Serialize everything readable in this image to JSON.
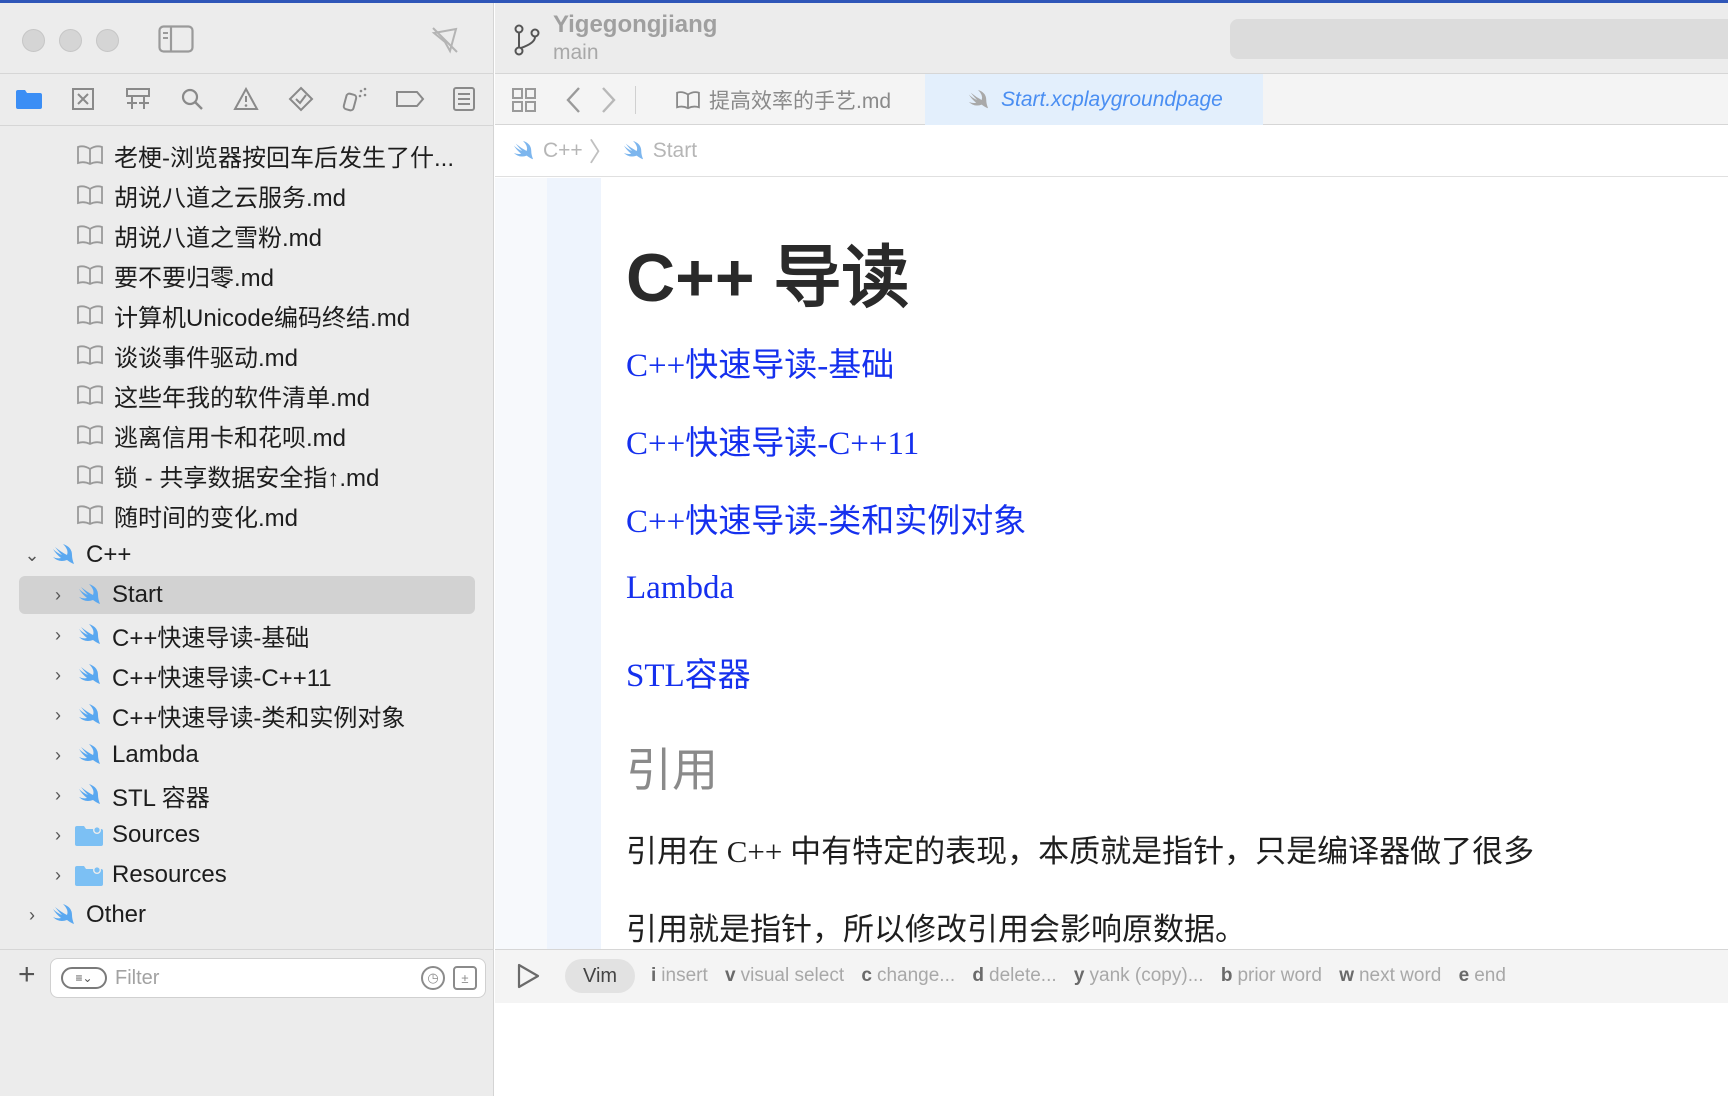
{
  "window": {
    "project_name": "Yigegongjiang",
    "branch": "main"
  },
  "navigator": {
    "filter_placeholder": "Filter",
    "items": [
      {
        "label": "老梗-浏览器按回车后发生了什...",
        "kind": "markdown"
      },
      {
        "label": "胡说八道之云服务.md",
        "kind": "markdown"
      },
      {
        "label": "胡说八道之雪粉.md",
        "kind": "markdown"
      },
      {
        "label": "要不要归零.md",
        "kind": "markdown"
      },
      {
        "label": "计算机Unicode编码终结.md",
        "kind": "markdown"
      },
      {
        "label": "谈谈事件驱动.md",
        "kind": "markdown"
      },
      {
        "label": "这些年我的软件清单.md",
        "kind": "markdown"
      },
      {
        "label": "逃离信用卡和花呗.md",
        "kind": "markdown"
      },
      {
        "label": "锁 - 共享数据安全指↑.md",
        "kind": "markdown"
      },
      {
        "label": "随时间的变化.md",
        "kind": "markdown"
      },
      {
        "label": "C++",
        "kind": "playground",
        "expanded": true
      },
      {
        "label": "Start",
        "kind": "playground-page",
        "selected": true
      },
      {
        "label": "C++快速导读-基础",
        "kind": "playground-page"
      },
      {
        "label": "C++快速导读-C++11",
        "kind": "playground-page"
      },
      {
        "label": "C++快速导读-类和实例对象",
        "kind": "playground-page"
      },
      {
        "label": "Lambda",
        "kind": "playground-page"
      },
      {
        "label": "STL 容器",
        "kind": "playground-page"
      },
      {
        "label": "Sources",
        "kind": "folder"
      },
      {
        "label": "Resources",
        "kind": "folder"
      },
      {
        "label": "Other",
        "kind": "playground"
      }
    ]
  },
  "tabs": [
    {
      "label": "提高效率的手艺.md",
      "active": false
    },
    {
      "label": "Start.xcplaygroundpage",
      "active": true
    }
  ],
  "breadcrumb": [
    "C++",
    "Start"
  ],
  "document": {
    "title": "C++ 导读",
    "links": [
      "C++快速导读-基础",
      "C++快速导读-C++11",
      "C++快速导读-类和实例对象",
      "Lambda",
      "STL容器"
    ],
    "heading": "引用",
    "paragraphs": [
      "引用在 C++ 中有特定的表现，本质就是指针，只是编译器做了很多",
      "引用就是指针，所以修改引用会影响原数据。"
    ]
  },
  "statusbar": {
    "mode": "Vim",
    "hints": [
      {
        "key": "i",
        "text": "insert"
      },
      {
        "key": "v",
        "text": "visual select"
      },
      {
        "key": "c",
        "text": "change..."
      },
      {
        "key": "d",
        "text": "delete..."
      },
      {
        "key": "y",
        "text": "yank (copy)..."
      },
      {
        "key": "b",
        "text": "prior word"
      },
      {
        "key": "w",
        "text": "next word"
      },
      {
        "key": "e",
        "text": "end"
      }
    ]
  },
  "colors": {
    "accent": "#3b8ef5",
    "link": "#1530ee",
    "selection": "#d2d2d2",
    "swift": "#5aa8f0"
  }
}
